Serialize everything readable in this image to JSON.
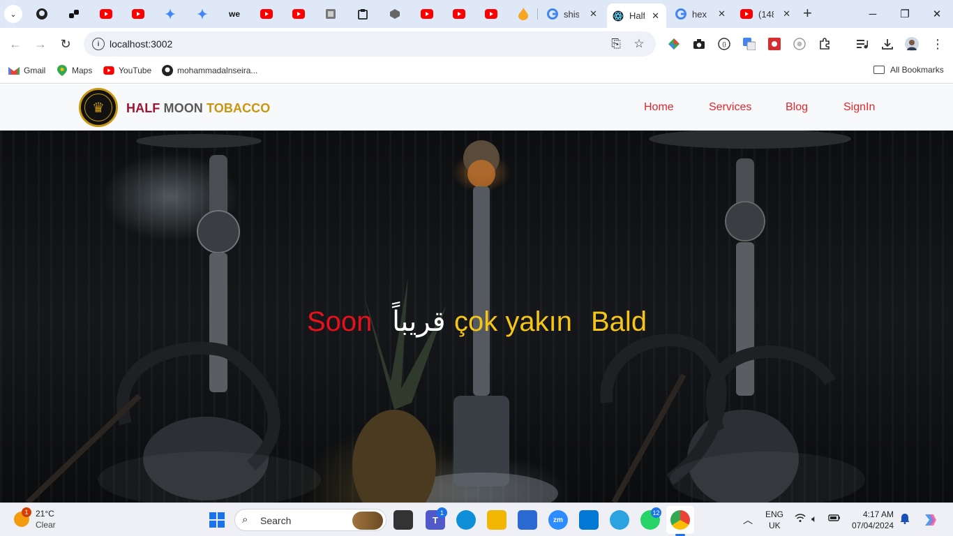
{
  "browser": {
    "tabs": [
      {
        "title": "shisl",
        "favicon": "google-icon"
      },
      {
        "title": "Half",
        "favicon": "react-icon",
        "active": true
      },
      {
        "title": "hex",
        "favicon": "google-icon"
      },
      {
        "title": "(148",
        "favicon": "youtube-icon"
      }
    ],
    "url": "localhost:3002",
    "bookmarks": [
      {
        "label": "Gmail",
        "icon": "gmail-icon"
      },
      {
        "label": "Maps",
        "icon": "maps-icon"
      },
      {
        "label": "YouTube",
        "icon": "youtube-icon"
      },
      {
        "label": "mohammadalnseira...",
        "icon": "github-icon"
      }
    ],
    "all_bookmarks": "All Bookmarks"
  },
  "site": {
    "brand": {
      "part1": "HALF",
      "part2": "MOON",
      "part3": "TOBACCO"
    },
    "nav": [
      {
        "label": "Home"
      },
      {
        "label": "Services"
      },
      {
        "label": "Blog"
      },
      {
        "label": "SignIn"
      }
    ],
    "hero_words": [
      {
        "text": "Soon",
        "color": "#e8111b"
      },
      {
        "text": "قريباً",
        "color": "#ffffff"
      },
      {
        "text": "çok yakın",
        "color": "#f5c518"
      },
      {
        "text": "Bald",
        "color": "#f5c518"
      }
    ],
    "colors": {
      "brand_red": "#9c1535",
      "brand_gray": "#5a5a5a",
      "brand_gold": "#c8960f",
      "nav_link": "#e2262e"
    }
  },
  "taskbar": {
    "weather": {
      "temp": "21°C",
      "condition": "Clear",
      "badge": "1"
    },
    "search_label": "Search",
    "badges": {
      "teams": "1",
      "whatsapp": "12"
    },
    "language": {
      "line1": "ENG",
      "line2": "UK"
    },
    "clock": {
      "time": "4:17 AM",
      "date": "07/04/2024"
    }
  }
}
